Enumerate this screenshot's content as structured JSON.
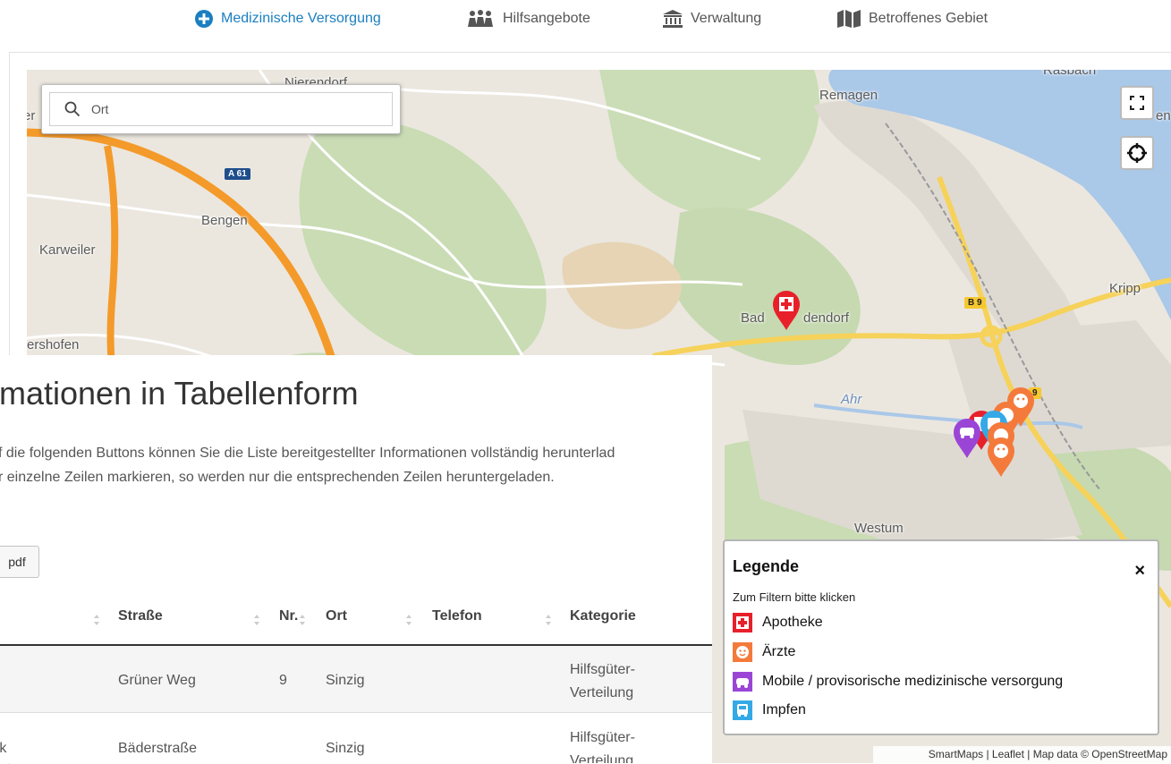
{
  "nav": {
    "items": [
      {
        "label": "Medizinische Versorgung",
        "icon": "plus-circle-icon",
        "active": true
      },
      {
        "label": "Hilfsangebote",
        "icon": "people-icon",
        "active": false
      },
      {
        "label": "Verwaltung",
        "icon": "institution-icon",
        "active": false
      },
      {
        "label": "Betroffenes Gebiet",
        "icon": "map-icon",
        "active": false
      }
    ]
  },
  "map": {
    "search_placeholder": "Ort",
    "places": {
      "nierendorf": "Nierendorf",
      "remagen": "Remagen",
      "bengen": "Bengen",
      "karweiler": "Karweiler",
      "kripp": "Kripp",
      "bad_bodendorf_a": "Bad",
      "bad_bodendorf_b": "dendorf",
      "ershofen": "ershofen",
      "westum": "Westum",
      "ahr": "Ahr",
      "rasbach": "Rasbach",
      "er": "er",
      "en": "en"
    },
    "roads": {
      "a61": "A 61",
      "b9a": "B 9",
      "b9b": "9"
    }
  },
  "content": {
    "heading": "rmationen in Tabellenform",
    "para_line1": "f die folgenden Buttons können Sie die Liste bereitgestellter Informationen vollständig herunterlad",
    "para_line2": "r einzelne Zeilen markieren, so werden nur die entsprechenden Zeilen heruntergeladen.",
    "pdf_label": "pdf",
    "table": {
      "headers": [
        "Straße",
        "Nr.",
        "Ort",
        "Telefon",
        "Kategorie"
      ],
      "rows": [
        {
          "name": "",
          "strasse": "Grüner Weg",
          "nr": "9",
          "ort": "Sinzig",
          "telefon": "",
          "kategorie_1": "Hilfsgüter-",
          "kategorie_2": "Verteilung"
        },
        {
          "name": "rk",
          "strasse": "Bäderstraße",
          "nr": "",
          "ort": "Sinzig",
          "telefon": "",
          "kategorie_1": "Hilfsgüter-",
          "kategorie_2": "Verteilung"
        }
      ]
    }
  },
  "legend": {
    "title": "Legende",
    "close": "×",
    "hint": "Zum Filtern bitte klicken",
    "items": [
      {
        "label": "Apotheke",
        "color": "#e8202a",
        "icon": "pharmacy-icon"
      },
      {
        "label": "Ärzte",
        "color": "#f47a3c",
        "icon": "doctor-icon"
      },
      {
        "label": "Mobile / provisorische medizinische versorgung",
        "color": "#9b45d6",
        "icon": "car-icon"
      },
      {
        "label": "Impfen",
        "color": "#35a9e6",
        "icon": "bus-icon"
      }
    ]
  },
  "attribution": "SmartMaps | Leaflet | Map data © OpenStreetMap"
}
